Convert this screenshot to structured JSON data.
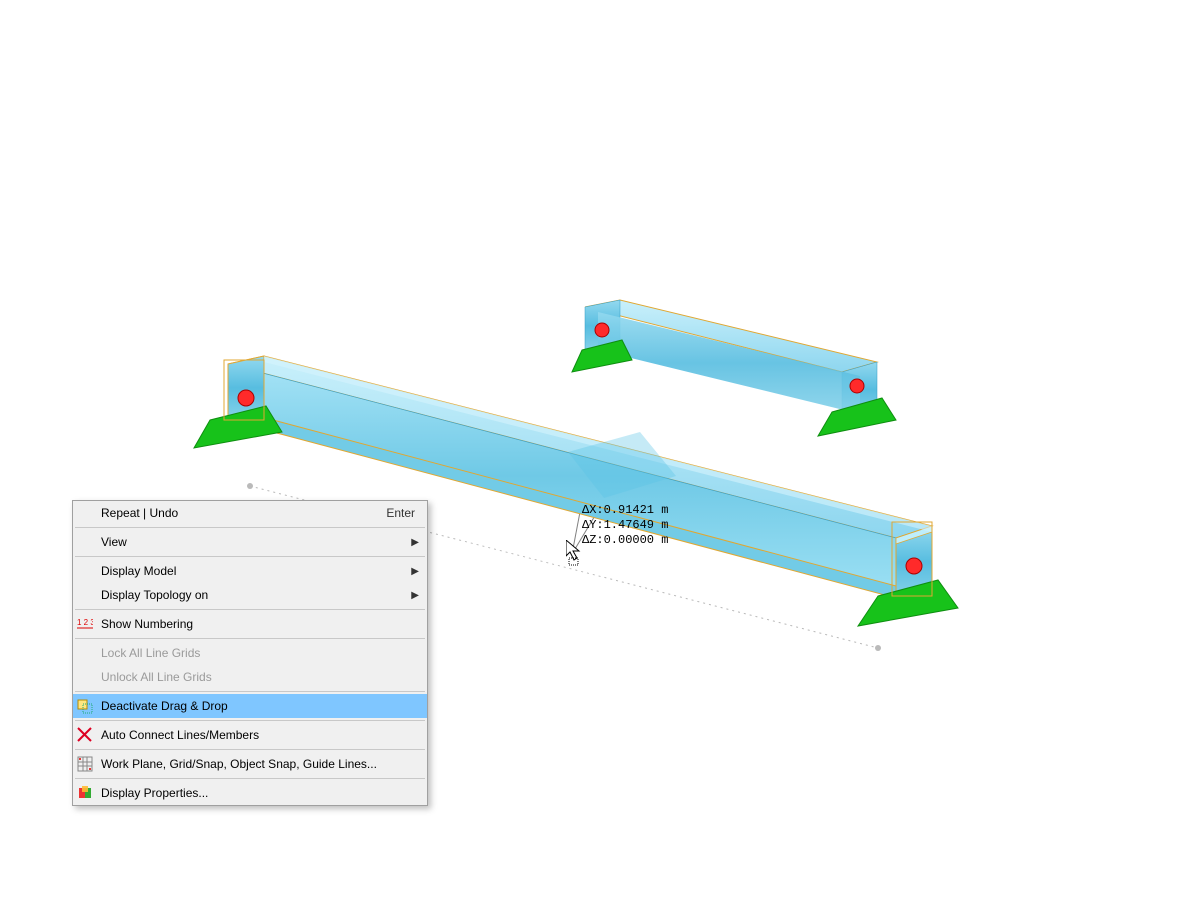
{
  "delta": {
    "dx_label": "ΔX:0.91421 m",
    "dy_label": "ΔY:1.47649 m",
    "dz_label": "ΔZ:0.00000 m"
  },
  "context_menu": {
    "repeat_undo": "Repeat | Undo",
    "repeat_undo_accel": "Enter",
    "view": "View",
    "display_model": "Display Model",
    "display_topology_on": "Display Topology on",
    "show_numbering": "Show Numbering",
    "lock_all_line_grids": "Lock All Line Grids",
    "unlock_all_line_grids": "Unlock All Line Grids",
    "deactivate_drag_drop": "Deactivate Drag & Drop",
    "auto_connect": "Auto Connect Lines/Members",
    "work_plane": "Work Plane, Grid/Snap, Object Snap, Guide Lines...",
    "display_properties": "Display Properties..."
  }
}
